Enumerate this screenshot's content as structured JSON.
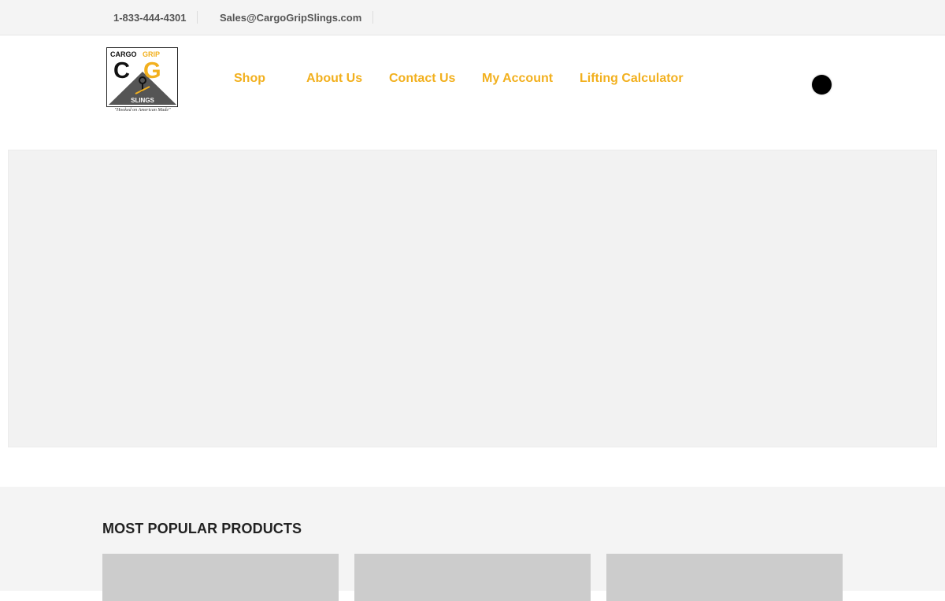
{
  "topbar": {
    "phone": "1-833-444-4301",
    "email": "Sales@CargoGripSlings.com"
  },
  "logo": {
    "top_text_dark": "CARGO",
    "top_text_accent": "GRIP",
    "mark_left": "C",
    "mark_right": "G",
    "bottom_text": "SLINGS",
    "tagline": "\"Hooked on American Made\""
  },
  "nav": {
    "items": [
      "Shop",
      "About Us",
      "Contact Us",
      "My Account",
      "Lifting Calculator"
    ]
  },
  "products": {
    "heading": "MOST POPULAR PRODUCTS"
  },
  "colors": {
    "accent": "#f2b01e",
    "topbar_bg": "#f4f4f4",
    "hero_bg": "#f2f2f2",
    "card_placeholder": "#cccccc"
  }
}
